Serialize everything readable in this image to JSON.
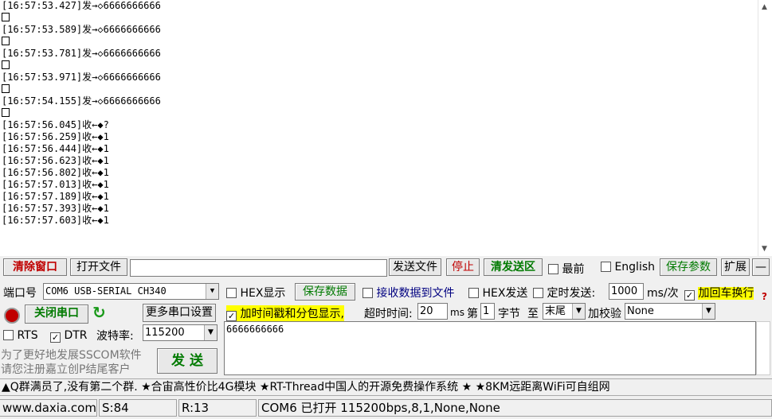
{
  "log": [
    {
      "text": "[16:57:53.427]发→◇6666666666"
    },
    {
      "box": true
    },
    {
      "text": "[16:57:53.589]发→◇6666666666"
    },
    {
      "box": true
    },
    {
      "text": "[16:57:53.781]发→◇6666666666"
    },
    {
      "box": true
    },
    {
      "text": "[16:57:53.971]发→◇6666666666"
    },
    {
      "box": true
    },
    {
      "text": "[16:57:54.155]发→◇6666666666"
    },
    {
      "box": true
    },
    {
      "text": "[16:57:56.045]收←◆?"
    },
    {
      "text": "[16:57:56.259]收←◆1"
    },
    {
      "text": "[16:57:56.444]收←◆1"
    },
    {
      "text": "[16:57:56.623]收←◆1"
    },
    {
      "text": "[16:57:56.802]收←◆1"
    },
    {
      "text": "[16:57:57.013]收←◆1"
    },
    {
      "text": "[16:57:57.189]收←◆1"
    },
    {
      "text": "[16:57:57.393]收←◆1"
    },
    {
      "text": "[16:57:57.603]收←◆1"
    }
  ],
  "toolbar": {
    "clear_window": "清除窗口",
    "open_file": "打开文件",
    "send_file": "发送文件",
    "stop": "停止",
    "clear_send": "清发送区",
    "topmost": "最前",
    "english": "English",
    "save_params": "保存参数",
    "expand": "扩展",
    "collapse": "—"
  },
  "port": {
    "label": "端口号",
    "value": "COM6 USB-SERIAL CH340",
    "close_port": "关闭串口",
    "more_settings": "更多串口设置",
    "rts": "RTS",
    "dtr": "DTR",
    "baud_label": "波特率:",
    "baud_value": "115200"
  },
  "options": {
    "hex_display": "HEX显示",
    "save_data": "保存数据",
    "recv_to_file": "接收数据到文件",
    "hex_send": "HEX发送",
    "timed_send": "定时发送:",
    "interval": "1000",
    "interval_unit": "ms/次",
    "add_crlf": "加回车换行",
    "timestamp": "加时间戳和分包显示,",
    "timeout_label": "超时时间:",
    "timeout_value": "20",
    "timeout_unit": "ms",
    "byte_prefix": "第",
    "byte_index": "1",
    "byte_suffix": "字节",
    "to_label": "至",
    "to_value": "末尾",
    "checksum_label": "加校验",
    "checksum_value": "None"
  },
  "send": {
    "content": "6666666666",
    "button": "发 送"
  },
  "tips": {
    "line1": "为了更好地发展SSCOM软件",
    "line2": "请您注册嘉立创P结尾客户"
  },
  "promo": "▲Q群满员了,没有第二个群. ★合宙高性价比4G模块 ★RT-Thread中国人的开源免费操作系统 ★ ★8KM远距离WiFi可自组网",
  "status": {
    "site": "www.daxia.com",
    "sent": "S:84",
    "received": "R:13",
    "port_info": "COM6 已打开  115200bps,8,1,None,None"
  }
}
